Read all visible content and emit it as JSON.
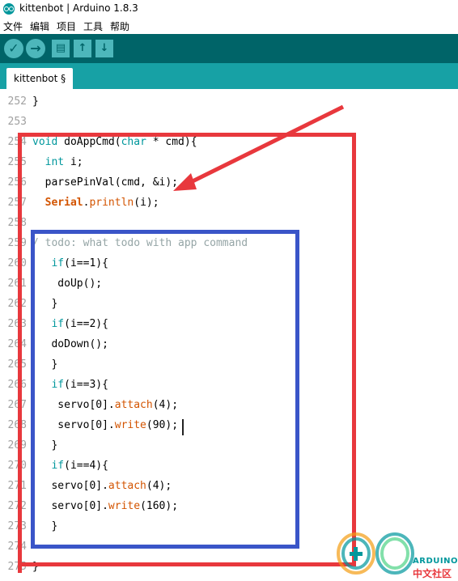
{
  "window": {
    "title": "kittenbot | Arduino 1.8.3"
  },
  "menu": [
    "文件",
    "编辑",
    "项目",
    "工具",
    "帮助"
  ],
  "toolbar": {
    "icons": [
      "verify-icon",
      "upload-icon",
      "new-icon",
      "open-icon",
      "save-icon"
    ]
  },
  "tabs": [
    {
      "label": "kittenbot §"
    }
  ],
  "editor": {
    "lines": [
      {
        "n": "252",
        "tokens": [
          {
            "t": "}",
            "c": ""
          }
        ]
      },
      {
        "n": "253",
        "tokens": []
      },
      {
        "n": "254",
        "tokens": [
          {
            "t": "void",
            "c": "kw"
          },
          {
            "t": " doAppCmd(",
            "c": ""
          },
          {
            "t": "char",
            "c": "kw"
          },
          {
            "t": " * cmd){",
            "c": ""
          }
        ]
      },
      {
        "n": "255",
        "tokens": [
          {
            "t": "  ",
            "c": ""
          },
          {
            "t": "int",
            "c": "kw"
          },
          {
            "t": " i;",
            "c": ""
          }
        ]
      },
      {
        "n": "256",
        "tokens": [
          {
            "t": "  parsePinVal(cmd, &i);",
            "c": ""
          }
        ]
      },
      {
        "n": "257",
        "tokens": [
          {
            "t": "  ",
            "c": ""
          },
          {
            "t": "Serial",
            "c": "cls"
          },
          {
            "t": ".",
            "c": ""
          },
          {
            "t": "println",
            "c": "fn"
          },
          {
            "t": "(i);",
            "c": ""
          }
        ]
      },
      {
        "n": "258",
        "tokens": []
      },
      {
        "n": "259",
        "tokens": [
          {
            "t": "/ todo: what todo with app command",
            "c": "cm"
          }
        ]
      },
      {
        "n": "260",
        "tokens": [
          {
            "t": "   ",
            "c": ""
          },
          {
            "t": "if",
            "c": "kw"
          },
          {
            "t": "(i==1){",
            "c": ""
          }
        ]
      },
      {
        "n": "261",
        "tokens": [
          {
            "t": "    doUp();",
            "c": ""
          }
        ]
      },
      {
        "n": "262",
        "tokens": [
          {
            "t": "   }",
            "c": ""
          }
        ]
      },
      {
        "n": "263",
        "tokens": [
          {
            "t": "   ",
            "c": ""
          },
          {
            "t": "if",
            "c": "kw"
          },
          {
            "t": "(i==2){",
            "c": ""
          }
        ]
      },
      {
        "n": "264",
        "tokens": [
          {
            "t": "   doDown();",
            "c": ""
          }
        ]
      },
      {
        "n": "265",
        "tokens": [
          {
            "t": "   }",
            "c": ""
          }
        ]
      },
      {
        "n": "266",
        "tokens": [
          {
            "t": "   ",
            "c": ""
          },
          {
            "t": "if",
            "c": "kw"
          },
          {
            "t": "(i==3){",
            "c": ""
          }
        ]
      },
      {
        "n": "267",
        "tokens": [
          {
            "t": "    servo[0].",
            "c": ""
          },
          {
            "t": "attach",
            "c": "fn"
          },
          {
            "t": "(4);",
            "c": ""
          }
        ]
      },
      {
        "n": "268",
        "tokens": [
          {
            "t": "    servo[0].",
            "c": ""
          },
          {
            "t": "write",
            "c": "fn"
          },
          {
            "t": "(90);",
            "c": ""
          }
        ]
      },
      {
        "n": "269",
        "tokens": [
          {
            "t": "   }",
            "c": ""
          }
        ]
      },
      {
        "n": "270",
        "tokens": [
          {
            "t": "   ",
            "c": ""
          },
          {
            "t": "if",
            "c": "kw"
          },
          {
            "t": "(i==4){",
            "c": ""
          }
        ]
      },
      {
        "n": "271",
        "tokens": [
          {
            "t": "   servo[0].",
            "c": ""
          },
          {
            "t": "attach",
            "c": "fn"
          },
          {
            "t": "(4);",
            "c": ""
          }
        ]
      },
      {
        "n": "272",
        "tokens": [
          {
            "t": "   servo[0].",
            "c": ""
          },
          {
            "t": "write",
            "c": "fn"
          },
          {
            "t": "(160);",
            "c": ""
          }
        ]
      },
      {
        "n": "273",
        "tokens": [
          {
            "t": "   }",
            "c": ""
          }
        ]
      },
      {
        "n": "274",
        "tokens": []
      },
      {
        "n": "275",
        "tokens": [
          {
            "t": "}",
            "c": ""
          }
        ]
      }
    ]
  },
  "colors": {
    "toolbar": "#006468",
    "tabbar": "#17a1a5",
    "annotation_red": "#e8383d",
    "annotation_blue": "#3a55c8"
  },
  "watermark": {
    "brand": "ARDUINO",
    "subtitle": "中文社区"
  }
}
